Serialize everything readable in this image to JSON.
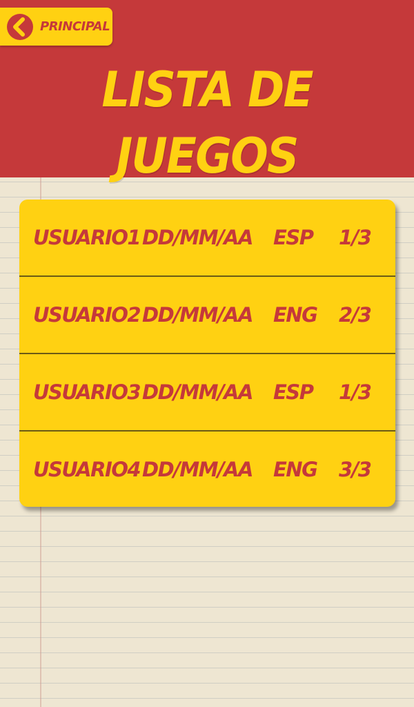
{
  "colors": {
    "header_bg": "#c5393a",
    "accent_yellow": "#ffd112",
    "text_red": "#c5393a"
  },
  "back_button": {
    "label": "PRINCIPAL",
    "icon": "chevron-left-icon"
  },
  "title": "LISTA DE JUEGOS",
  "games": [
    {
      "user": "USUARIO1",
      "date": "DD/MM/AA",
      "lang": "ESP",
      "progress": "1/3"
    },
    {
      "user": "USUARIO2",
      "date": "DD/MM/AA",
      "lang": "ENG",
      "progress": "2/3"
    },
    {
      "user": "USUARIO3",
      "date": "DD/MM/AA",
      "lang": "ESP",
      "progress": "1/3"
    },
    {
      "user": "USUARIO4",
      "date": "DD/MM/AA",
      "lang": "ENG",
      "progress": "3/3"
    }
  ]
}
